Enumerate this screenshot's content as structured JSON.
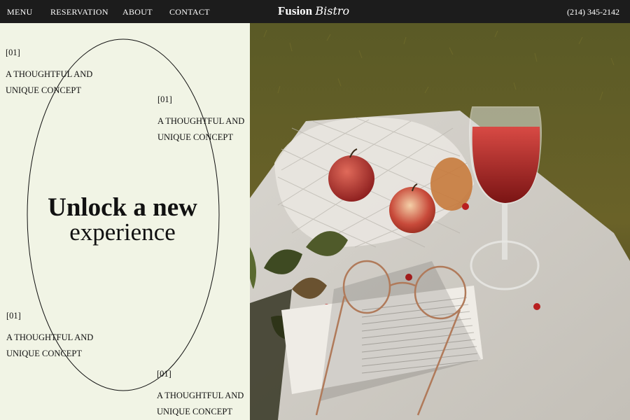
{
  "nav": {
    "menu": "MENU",
    "reservation": "RESERVATION",
    "about": "ABOUT",
    "contact": "CONTACT"
  },
  "brand": {
    "part1": "Fusion",
    "part2": "Bistro"
  },
  "phone": "(214) 345-2142",
  "concepts": [
    {
      "num": "[01]",
      "line1": "A THOUGHTFUL AND",
      "line2": "UNIQUE CONCEPT"
    },
    {
      "num": "[01]",
      "line1": "A THOUGHTFUL AND",
      "line2": "UNIQUE CONCEPT"
    },
    {
      "num": "[01]",
      "line1": "A THOUGHTFUL AND",
      "line2": "UNIQUE CONCEPT"
    },
    {
      "num": "[01]",
      "line1": "A THOUGHTFUL AND",
      "line2": "UNIQUE CONCEPT"
    }
  ],
  "hero": {
    "line1": "Unlock a new",
    "line2": "experience"
  },
  "colors": {
    "bar": "#1c1c1c",
    "panel": "#f1f4e5",
    "ink": "#111111"
  }
}
